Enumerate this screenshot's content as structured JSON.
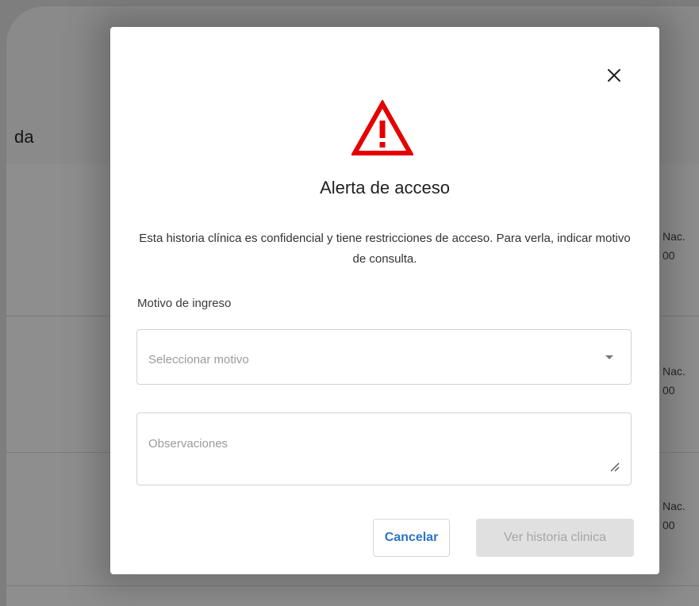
{
  "background": {
    "heading_fragment": "da",
    "rows": [
      {
        "label": "Nac.",
        "value": "00"
      },
      {
        "label": "Nac.",
        "value": "00"
      },
      {
        "label": "Nac.",
        "value": "00"
      }
    ]
  },
  "modal": {
    "title": "Alerta de acceso",
    "message": "Esta historia clínica es confidencial y tiene restricciones de acceso. Para verla, indicar motivo de consulta.",
    "reason_label": "Motivo de ingreso",
    "reason_select": {
      "placeholder": "Seleccionar motivo"
    },
    "observations": {
      "placeholder": "Observaciones"
    },
    "cancel_label": "Cancelar",
    "confirm_label": "Ver historia clinica"
  },
  "icons": {
    "close": "close-icon",
    "warning": "warning-triangle-icon",
    "dropdown": "chevron-down-icon",
    "resize": "resize-handle-icon"
  },
  "colors": {
    "warning": "#e50000",
    "link_blue": "#2c73c6",
    "disabled_bg": "#e0e0e0",
    "disabled_text": "#a6a6a6"
  }
}
